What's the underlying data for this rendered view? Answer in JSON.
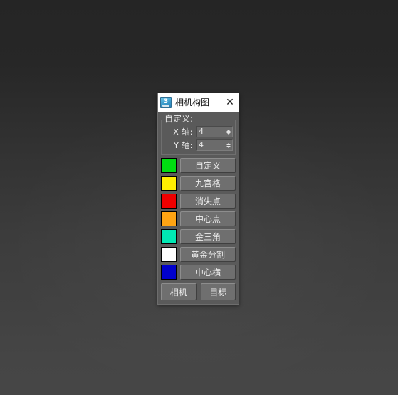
{
  "desktop": {
    "background_top": "#252525",
    "background_bottom": "#464646"
  },
  "dialog": {
    "title": "相机构图",
    "icon_name": "3dsmax-app-icon",
    "icon_glyph": "3",
    "close_label": "✕",
    "group": {
      "title": "自定义:",
      "fields": [
        {
          "label": "X 轴:",
          "value": "4"
        },
        {
          "label": "Y 轴:",
          "value": "4"
        }
      ]
    },
    "rows": [
      {
        "color": "#00dd11",
        "label": "自定义"
      },
      {
        "color": "#ffee00",
        "label": "九宫格"
      },
      {
        "color": "#ee0000",
        "label": "消失点"
      },
      {
        "color": "#ffa413",
        "label": "中心点"
      },
      {
        "color": "#00e8b4",
        "label": "金三角"
      },
      {
        "color": "#ffffff",
        "label": "黄金分割"
      },
      {
        "color": "#0000cc",
        "label": "中心横"
      }
    ],
    "bottom_buttons": [
      {
        "label": "相机"
      },
      {
        "label": "目标"
      }
    ]
  }
}
